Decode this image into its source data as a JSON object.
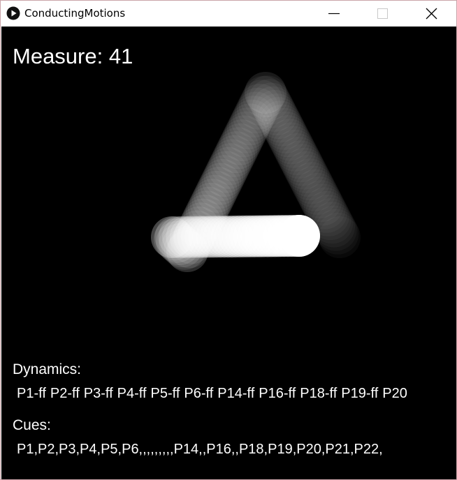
{
  "window": {
    "title": "ConductingMotions",
    "icon": "play-circle-icon",
    "controls": {
      "minimize_icon": "minimize-icon",
      "maximize_icon": "maximize-icon",
      "close_icon": "close-icon"
    }
  },
  "canvas": {
    "background": "#000000",
    "measure_text": "Measure: 41",
    "dynamics_label": "Dynamics:",
    "dynamics": [
      "P1-ff",
      "P2-ff",
      "P3-ff",
      "P4-ff",
      "P5-ff",
      "P6-ff",
      "P14-ff",
      "P16-ff",
      "P18-ff",
      "P19-ff",
      "P20"
    ],
    "cues_label": "Cues:",
    "cues_text": "P1,P2,P3,P4,P5,P6,,,,,,,,,P14,,P16,,P18,P19,P20,P21,P22,"
  },
  "colors": {
    "trail": "#ffffff",
    "text": "#ffffff"
  }
}
